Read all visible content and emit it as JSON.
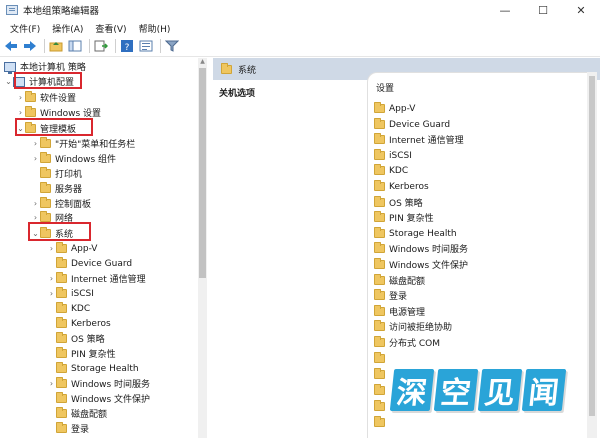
{
  "window": {
    "title": "本地组策略编辑器",
    "controls": [
      "—",
      "☐",
      "✕"
    ]
  },
  "menu": [
    "文件(F)",
    "操作(A)",
    "查看(V)",
    "帮助(H)"
  ],
  "toolbar_icons": [
    "back-icon",
    "forward-icon",
    "up-folder-icon",
    "show-tree-icon",
    "export-icon",
    "help-icon",
    "properties-icon",
    "filter-icon"
  ],
  "tree": {
    "root": "本地计算机 策略",
    "computer_config": "计算机配置",
    "software_settings": "软件设置",
    "windows_settings": "Windows 设置",
    "admin_templates": "管理模板",
    "admin_children": [
      "\"开始\"菜单和任务栏",
      "Windows 组件",
      "打印机",
      "服务器",
      "控制面板",
      "网络"
    ],
    "system": "系统",
    "system_children": [
      "App-V",
      "Device Guard",
      "Internet 通信管理",
      "iSCSI",
      "KDC",
      "Kerberos",
      "OS 策略",
      "PIN 复杂性",
      "Storage Health",
      "Windows 时间服务",
      "Windows 文件保护",
      "磁盘配额",
      "登录"
    ]
  },
  "right": {
    "header": "系统",
    "desc_label": "关机选项",
    "column": "设置",
    "items": [
      "App-V",
      "Device Guard",
      "Internet 通信管理",
      "iSCSI",
      "KDC",
      "Kerberos",
      "OS 策略",
      "PIN 复杂性",
      "Storage Health",
      "Windows 时间服务",
      "Windows 文件保护",
      "磁盘配额",
      "登录",
      "电源管理",
      "访问被拒绝协助",
      "分布式 COM"
    ]
  },
  "watermark": [
    "深",
    "空",
    "见",
    "闻"
  ],
  "colors": {
    "highlight": "#d9272e",
    "header_bg": "#cfd9e6",
    "folder": "#efc660",
    "watermark": "#2aa4d8"
  }
}
